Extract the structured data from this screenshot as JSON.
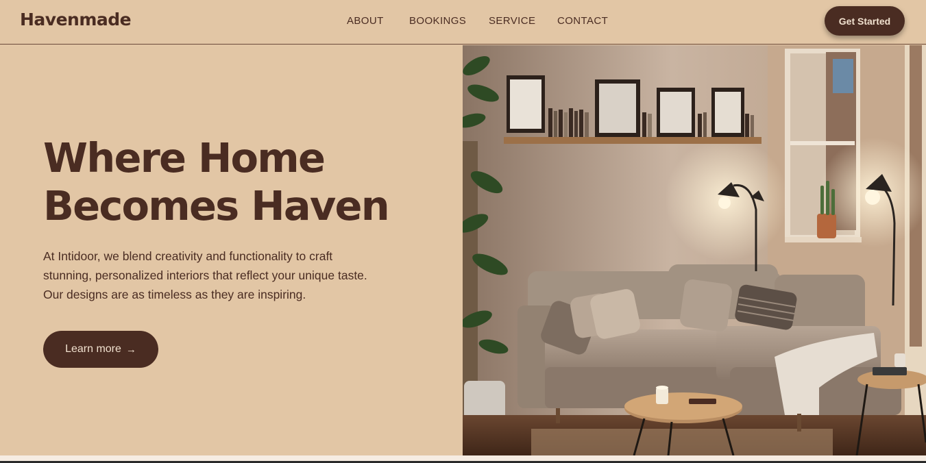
{
  "brand": {
    "name": "Havenmade"
  },
  "nav": {
    "links": [
      {
        "label": "ABOUT"
      },
      {
        "label": "BOOKINGS"
      },
      {
        "label": "SERVICE"
      },
      {
        "label": "CONTACT"
      }
    ],
    "cta_label": "Get Started"
  },
  "hero": {
    "title_line1": "Where Home",
    "title_line2": "Becomes Haven",
    "description_line1": "At Intidoor, we blend creativity and functionality to craft",
    "description_line2": "stunning, personalized interiors that reflect your unique taste.",
    "description_line3": "Our designs are as timeless as they are inspiring.",
    "button_label": "Learn more",
    "button_icon": "arrow-right-icon",
    "image_alt": "Cozy living room with sectional sofa, shelf, lamps and plants"
  },
  "colors": {
    "background": "#e2c6a5",
    "primary": "#4a2c22",
    "button_text": "#f1e1cf"
  }
}
